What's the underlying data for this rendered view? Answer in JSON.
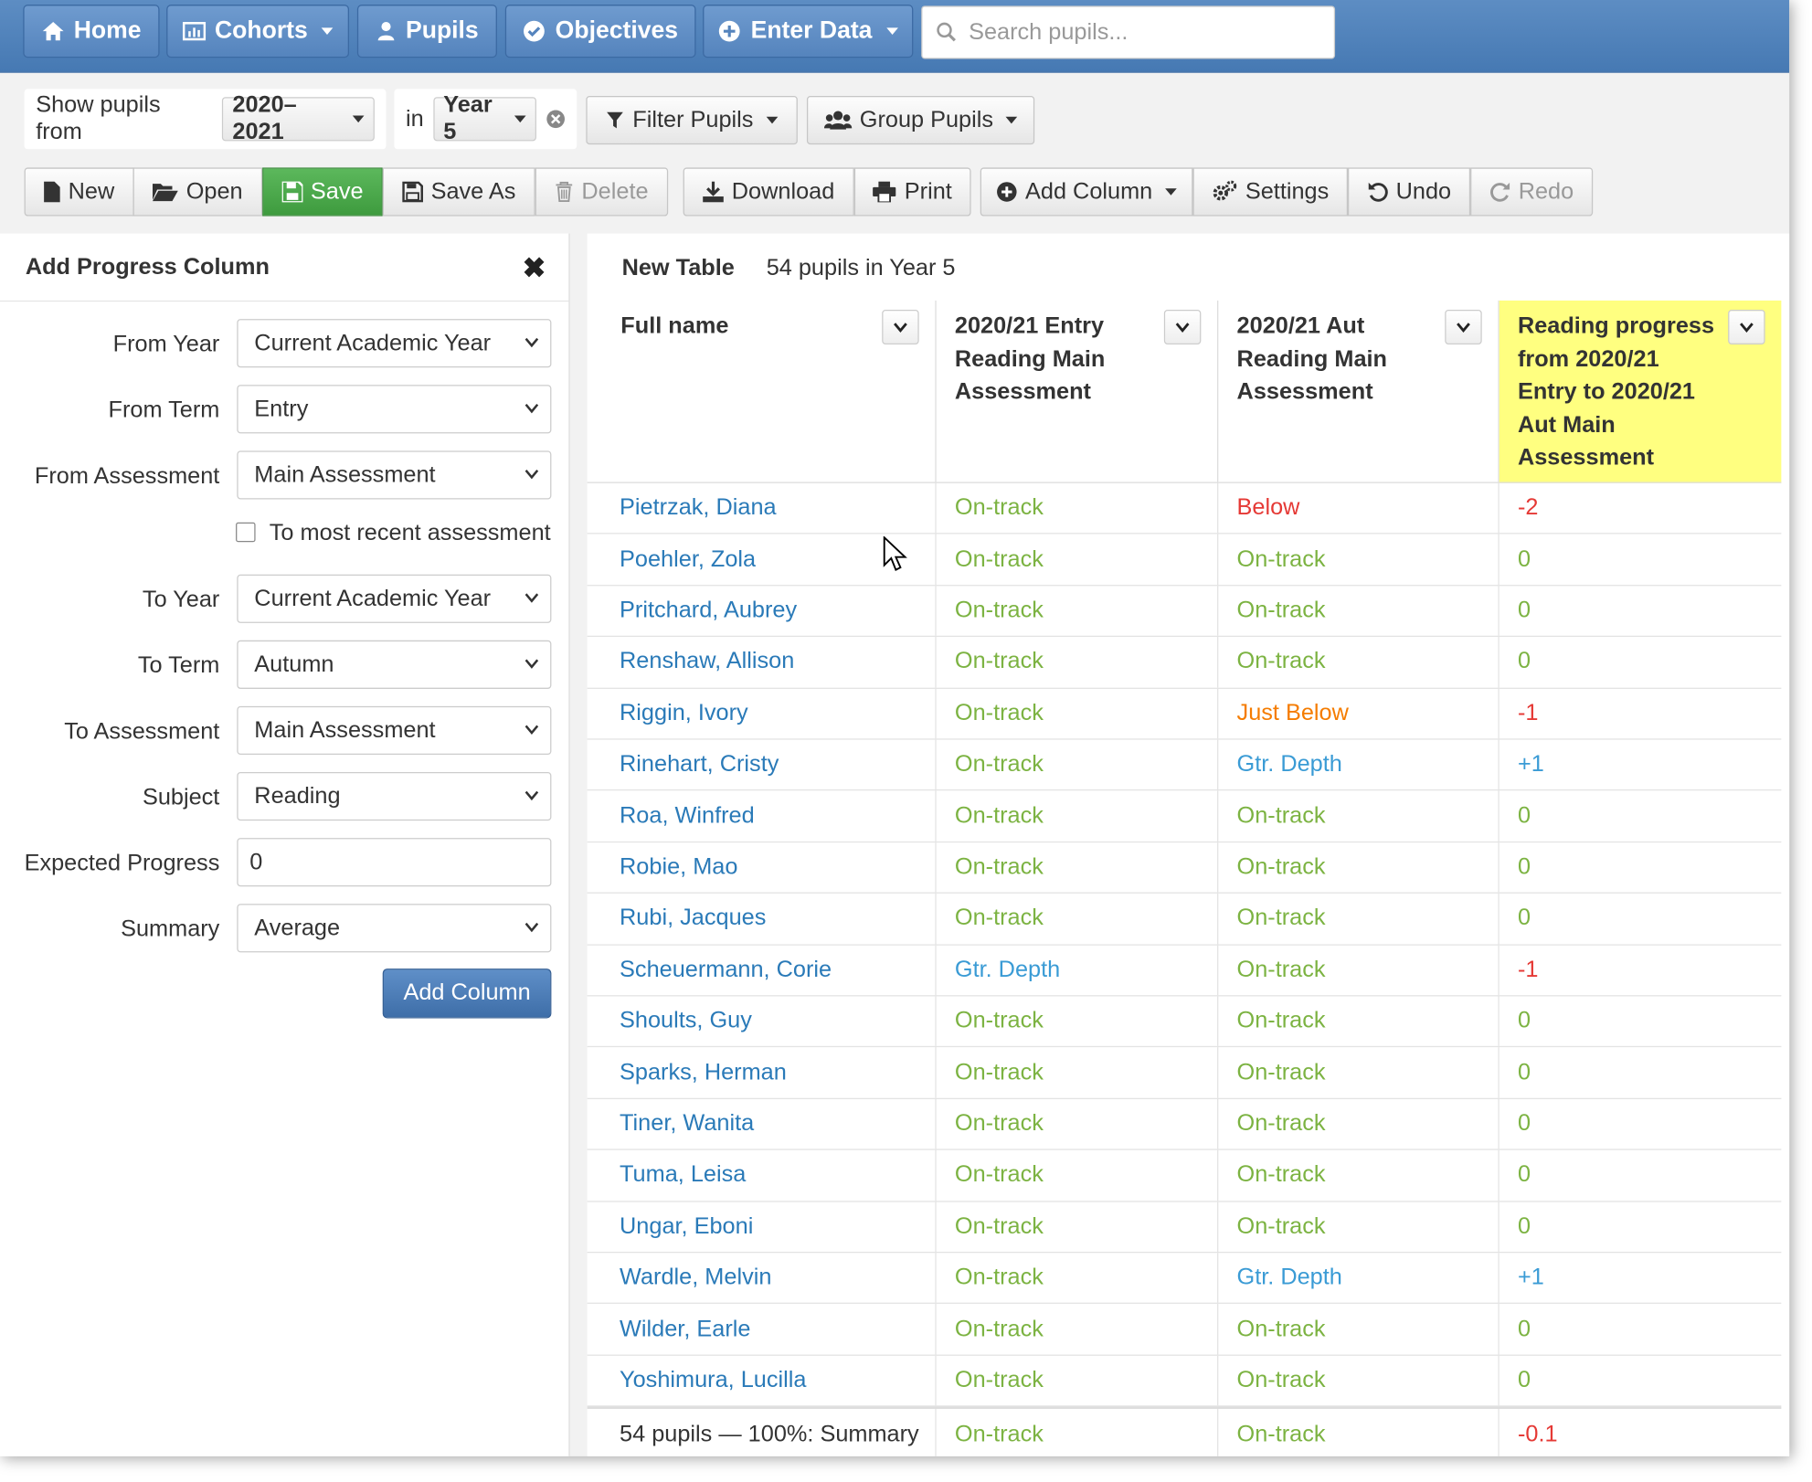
{
  "nav": {
    "home": "Home",
    "cohorts": "Cohorts",
    "pupils": "Pupils",
    "objectives": "Objectives",
    "enter_data": "Enter Data",
    "search_placeholder": "Search pupils..."
  },
  "filters": {
    "show_from_label": "Show pupils from",
    "year_range": "2020–2021",
    "in_label": "in",
    "year_group": "Year 5",
    "filter_pupils": "Filter Pupils",
    "group_pupils": "Group Pupils"
  },
  "toolbar": {
    "new": "New",
    "open": "Open",
    "save": "Save",
    "save_as": "Save As",
    "delete": "Delete",
    "download": "Download",
    "print": "Print",
    "add_column": "Add Column",
    "settings": "Settings",
    "undo": "Undo",
    "redo": "Redo"
  },
  "panel": {
    "title": "Add Progress Column",
    "fields": {
      "from_year_label": "From Year",
      "from_year_value": "Current Academic Year",
      "from_term_label": "From Term",
      "from_term_value": "Entry",
      "from_assessment_label": "From Assessment",
      "from_assessment_value": "Main Assessment",
      "most_recent_label": "To most recent assessment",
      "to_year_label": "To Year",
      "to_year_value": "Current Academic Year",
      "to_term_label": "To Term",
      "to_term_value": "Autumn",
      "to_assessment_label": "To Assessment",
      "to_assessment_value": "Main Assessment",
      "subject_label": "Subject",
      "subject_value": "Reading",
      "expected_progress_label": "Expected Progress",
      "expected_progress_value": "0",
      "summary_label": "Summary",
      "summary_value": "Average"
    },
    "add_button": "Add Column"
  },
  "table": {
    "title": "New Table",
    "subtitle": "54 pupils in Year 5",
    "headers": [
      "Full name",
      "2020/21 Entry Reading Main Assessment",
      "2020/21 Aut Reading Main Assessment",
      "Reading progress from 2020/21 Entry to 2020/21 Aut Main Assessment"
    ],
    "highlight_color": "#ffff80",
    "status_colors": {
      "On-track": "#7cb342",
      "Below": "#e53935",
      "Just Below": "#f57c00",
      "Gtr. Depth": "#3a9bd5"
    },
    "progress_colors": {
      "negative": "#e53935",
      "zero": "#7cb342",
      "positive": "#3a9bd5"
    },
    "rows": [
      {
        "name": "Pietrzak, Diana",
        "entry": "On-track",
        "aut": "Below",
        "progress": "-2"
      },
      {
        "name": "Poehler, Zola",
        "entry": "On-track",
        "aut": "On-track",
        "progress": "0"
      },
      {
        "name": "Pritchard, Aubrey",
        "entry": "On-track",
        "aut": "On-track",
        "progress": "0"
      },
      {
        "name": "Renshaw, Allison",
        "entry": "On-track",
        "aut": "On-track",
        "progress": "0"
      },
      {
        "name": "Riggin, Ivory",
        "entry": "On-track",
        "aut": "Just Below",
        "progress": "-1"
      },
      {
        "name": "Rinehart, Cristy",
        "entry": "On-track",
        "aut": "Gtr. Depth",
        "progress": "+1"
      },
      {
        "name": "Roa, Winfred",
        "entry": "On-track",
        "aut": "On-track",
        "progress": "0"
      },
      {
        "name": "Robie, Mao",
        "entry": "On-track",
        "aut": "On-track",
        "progress": "0"
      },
      {
        "name": "Rubi, Jacques",
        "entry": "On-track",
        "aut": "On-track",
        "progress": "0"
      },
      {
        "name": "Scheuermann, Corie",
        "entry": "Gtr. Depth",
        "aut": "On-track",
        "progress": "-1"
      },
      {
        "name": "Shoults, Guy",
        "entry": "On-track",
        "aut": "On-track",
        "progress": "0"
      },
      {
        "name": "Sparks, Herman",
        "entry": "On-track",
        "aut": "On-track",
        "progress": "0"
      },
      {
        "name": "Tiner, Wanita",
        "entry": "On-track",
        "aut": "On-track",
        "progress": "0"
      },
      {
        "name": "Tuma, Leisa",
        "entry": "On-track",
        "aut": "On-track",
        "progress": "0"
      },
      {
        "name": "Ungar, Eboni",
        "entry": "On-track",
        "aut": "On-track",
        "progress": "0"
      },
      {
        "name": "Wardle, Melvin",
        "entry": "On-track",
        "aut": "Gtr. Depth",
        "progress": "+1"
      },
      {
        "name": "Wilder, Earle",
        "entry": "On-track",
        "aut": "On-track",
        "progress": "0"
      },
      {
        "name": "Yoshimura, Lucilla",
        "entry": "On-track",
        "aut": "On-track",
        "progress": "0"
      }
    ],
    "summary": {
      "label": "54 pupils — 100%: Summary",
      "entry": "On-track",
      "aut": "On-track",
      "progress": "-0.1"
    }
  }
}
